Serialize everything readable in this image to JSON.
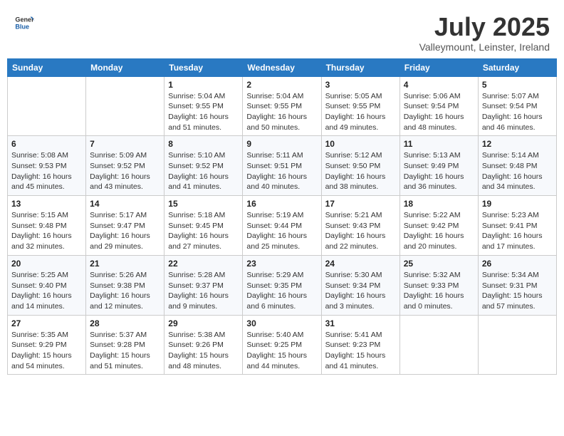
{
  "header": {
    "logo_general": "General",
    "logo_blue": "Blue",
    "month": "July 2025",
    "location": "Valleymount, Leinster, Ireland"
  },
  "weekdays": [
    "Sunday",
    "Monday",
    "Tuesday",
    "Wednesday",
    "Thursday",
    "Friday",
    "Saturday"
  ],
  "weeks": [
    [
      {
        "day": "",
        "info": ""
      },
      {
        "day": "",
        "info": ""
      },
      {
        "day": "1",
        "info": "Sunrise: 5:04 AM\nSunset: 9:55 PM\nDaylight: 16 hours\nand 51 minutes."
      },
      {
        "day": "2",
        "info": "Sunrise: 5:04 AM\nSunset: 9:55 PM\nDaylight: 16 hours\nand 50 minutes."
      },
      {
        "day": "3",
        "info": "Sunrise: 5:05 AM\nSunset: 9:55 PM\nDaylight: 16 hours\nand 49 minutes."
      },
      {
        "day": "4",
        "info": "Sunrise: 5:06 AM\nSunset: 9:54 PM\nDaylight: 16 hours\nand 48 minutes."
      },
      {
        "day": "5",
        "info": "Sunrise: 5:07 AM\nSunset: 9:54 PM\nDaylight: 16 hours\nand 46 minutes."
      }
    ],
    [
      {
        "day": "6",
        "info": "Sunrise: 5:08 AM\nSunset: 9:53 PM\nDaylight: 16 hours\nand 45 minutes."
      },
      {
        "day": "7",
        "info": "Sunrise: 5:09 AM\nSunset: 9:52 PM\nDaylight: 16 hours\nand 43 minutes."
      },
      {
        "day": "8",
        "info": "Sunrise: 5:10 AM\nSunset: 9:52 PM\nDaylight: 16 hours\nand 41 minutes."
      },
      {
        "day": "9",
        "info": "Sunrise: 5:11 AM\nSunset: 9:51 PM\nDaylight: 16 hours\nand 40 minutes."
      },
      {
        "day": "10",
        "info": "Sunrise: 5:12 AM\nSunset: 9:50 PM\nDaylight: 16 hours\nand 38 minutes."
      },
      {
        "day": "11",
        "info": "Sunrise: 5:13 AM\nSunset: 9:49 PM\nDaylight: 16 hours\nand 36 minutes."
      },
      {
        "day": "12",
        "info": "Sunrise: 5:14 AM\nSunset: 9:48 PM\nDaylight: 16 hours\nand 34 minutes."
      }
    ],
    [
      {
        "day": "13",
        "info": "Sunrise: 5:15 AM\nSunset: 9:48 PM\nDaylight: 16 hours\nand 32 minutes."
      },
      {
        "day": "14",
        "info": "Sunrise: 5:17 AM\nSunset: 9:47 PM\nDaylight: 16 hours\nand 29 minutes."
      },
      {
        "day": "15",
        "info": "Sunrise: 5:18 AM\nSunset: 9:45 PM\nDaylight: 16 hours\nand 27 minutes."
      },
      {
        "day": "16",
        "info": "Sunrise: 5:19 AM\nSunset: 9:44 PM\nDaylight: 16 hours\nand 25 minutes."
      },
      {
        "day": "17",
        "info": "Sunrise: 5:21 AM\nSunset: 9:43 PM\nDaylight: 16 hours\nand 22 minutes."
      },
      {
        "day": "18",
        "info": "Sunrise: 5:22 AM\nSunset: 9:42 PM\nDaylight: 16 hours\nand 20 minutes."
      },
      {
        "day": "19",
        "info": "Sunrise: 5:23 AM\nSunset: 9:41 PM\nDaylight: 16 hours\nand 17 minutes."
      }
    ],
    [
      {
        "day": "20",
        "info": "Sunrise: 5:25 AM\nSunset: 9:40 PM\nDaylight: 16 hours\nand 14 minutes."
      },
      {
        "day": "21",
        "info": "Sunrise: 5:26 AM\nSunset: 9:38 PM\nDaylight: 16 hours\nand 12 minutes."
      },
      {
        "day": "22",
        "info": "Sunrise: 5:28 AM\nSunset: 9:37 PM\nDaylight: 16 hours\nand 9 minutes."
      },
      {
        "day": "23",
        "info": "Sunrise: 5:29 AM\nSunset: 9:35 PM\nDaylight: 16 hours\nand 6 minutes."
      },
      {
        "day": "24",
        "info": "Sunrise: 5:30 AM\nSunset: 9:34 PM\nDaylight: 16 hours\nand 3 minutes."
      },
      {
        "day": "25",
        "info": "Sunrise: 5:32 AM\nSunset: 9:33 PM\nDaylight: 16 hours\nand 0 minutes."
      },
      {
        "day": "26",
        "info": "Sunrise: 5:34 AM\nSunset: 9:31 PM\nDaylight: 15 hours\nand 57 minutes."
      }
    ],
    [
      {
        "day": "27",
        "info": "Sunrise: 5:35 AM\nSunset: 9:29 PM\nDaylight: 15 hours\nand 54 minutes."
      },
      {
        "day": "28",
        "info": "Sunrise: 5:37 AM\nSunset: 9:28 PM\nDaylight: 15 hours\nand 51 minutes."
      },
      {
        "day": "29",
        "info": "Sunrise: 5:38 AM\nSunset: 9:26 PM\nDaylight: 15 hours\nand 48 minutes."
      },
      {
        "day": "30",
        "info": "Sunrise: 5:40 AM\nSunset: 9:25 PM\nDaylight: 15 hours\nand 44 minutes."
      },
      {
        "day": "31",
        "info": "Sunrise: 5:41 AM\nSunset: 9:23 PM\nDaylight: 15 hours\nand 41 minutes."
      },
      {
        "day": "",
        "info": ""
      },
      {
        "day": "",
        "info": ""
      }
    ]
  ]
}
